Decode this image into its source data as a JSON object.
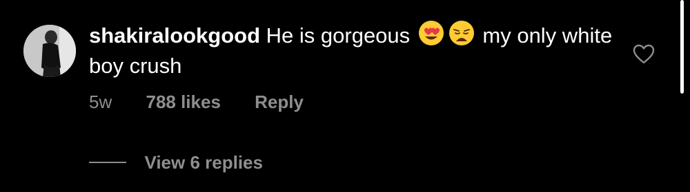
{
  "comment": {
    "avatar_icon": "avatar",
    "username": "shakiralookgood",
    "text_before": " He is gorgeous ",
    "emojis": [
      "heart-eyes-emoji",
      "weary-face-emoji"
    ],
    "text_after": " my only white boy crush",
    "time": "5w",
    "likes": "788 likes",
    "reply_label": "Reply",
    "like_icon": "heart-outline-icon"
  },
  "replies": {
    "label": "View 6 replies"
  },
  "colors": {
    "background": "#000000",
    "text": "#ffffff",
    "secondary": "#8e8e8e"
  }
}
